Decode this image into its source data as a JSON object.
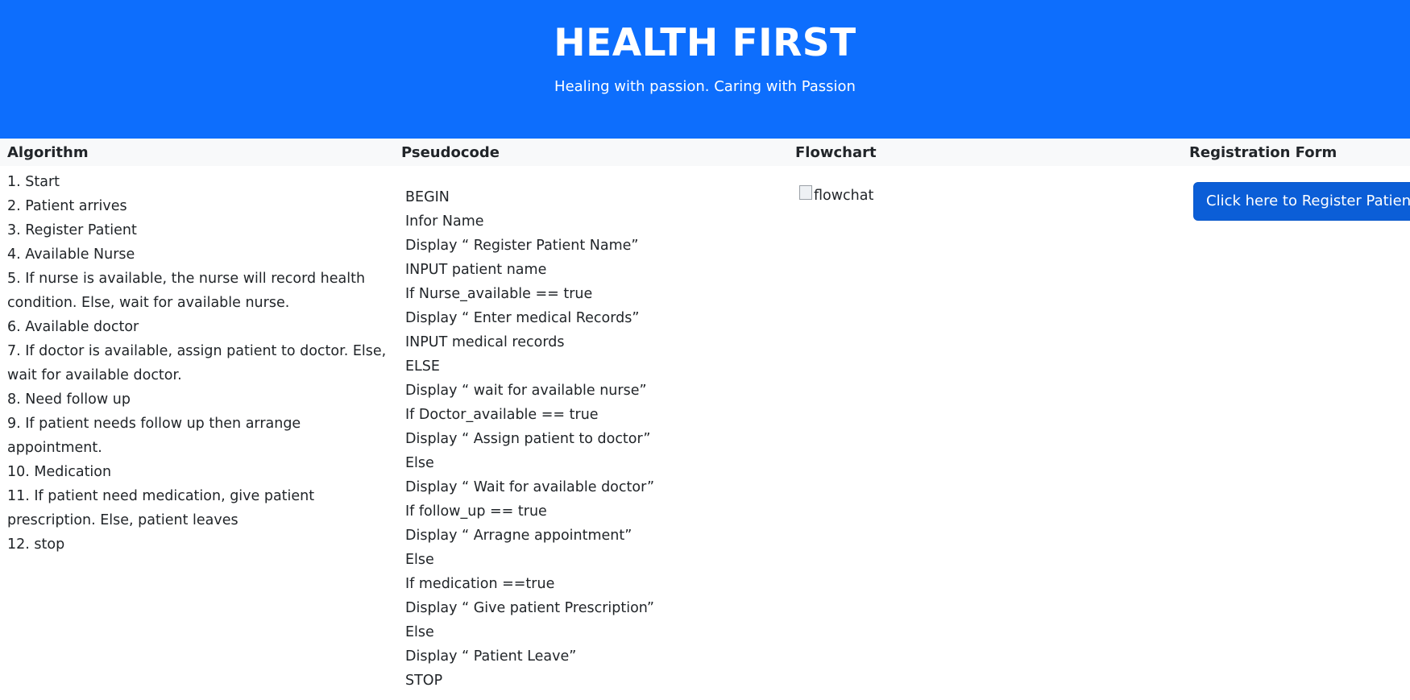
{
  "header": {
    "title": "HEALTH FIRST",
    "subtitle": "Healing with passion. Caring with Passion"
  },
  "columns": {
    "algorithm": "Algorithm",
    "pseudocode": "Pseudocode",
    "flowchart": "Flowchart",
    "registration": "Registration Form"
  },
  "algorithm_steps": [
    "1. Start",
    "2. Patient arrives",
    "3. Register Patient",
    "4. Available Nurse",
    "5. If nurse is available, the nurse will record health condition. Else, wait for available nurse.",
    "6. Available doctor",
    "7. If doctor is available, assign patient to doctor. Else, wait for available doctor.",
    "8. Need follow up",
    "9. If patient needs follow up then arrange appointment.",
    "10. Medication",
    "11. If patient need medication, give patient prescription. Else, patient leaves",
    "12. stop"
  ],
  "pseudocode_lines": [
    "BEGIN",
    "Infor Name",
    "Display “ Register Patient Name”",
    "INPUT patient name",
    "If Nurse_available == true",
    "Display “ Enter medical Records”",
    "INPUT medical records",
    "ELSE",
    "Display “ wait for available nurse”",
    "If Doctor_available == true",
    "Display “ Assign patient to doctor”",
    "Else",
    "Display “ Wait for available doctor”",
    "If follow_up == true",
    "Display “ Arragne appointment”",
    "Else",
    "If medication ==true",
    "Display “ Give patient Prescription”",
    "Else",
    "Display “ Patient Leave”",
    "STOP"
  ],
  "flowchart": {
    "alt_text": "flowchat",
    "icon": "broken-image-icon"
  },
  "registration": {
    "button_label": "Click here to Register Patient"
  },
  "colors": {
    "header_bg": "#0d6efd",
    "button_bg": "#0b5ed7",
    "table_head_bg": "#f8f9fa"
  }
}
